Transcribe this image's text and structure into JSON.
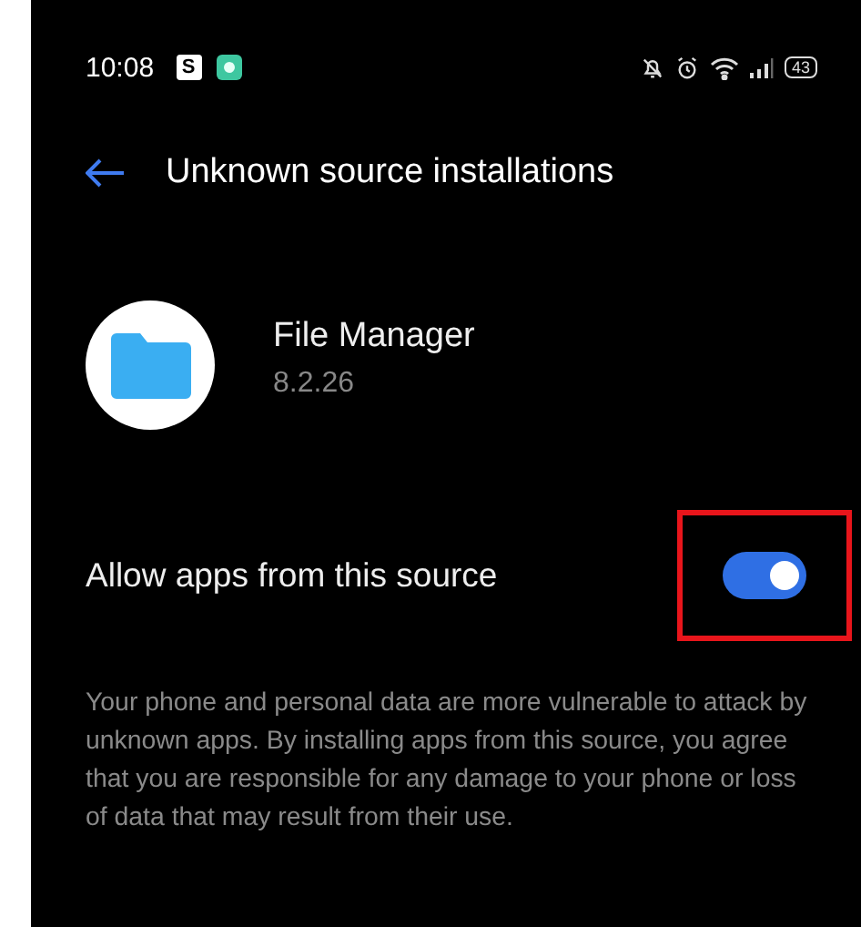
{
  "status_bar": {
    "time": "10:08",
    "notification_letter": "S",
    "battery": "43"
  },
  "header": {
    "title": "Unknown source installations"
  },
  "app": {
    "name": "File Manager",
    "version": "8.2.26"
  },
  "setting": {
    "label": "Allow apps from this source",
    "on": true,
    "highlighted": true
  },
  "description": "Your phone and personal data are more vulnerable to attack by unknown apps. By installing apps from this source, you agree that you are responsible for any damage to your phone or loss of data that may result from their use."
}
